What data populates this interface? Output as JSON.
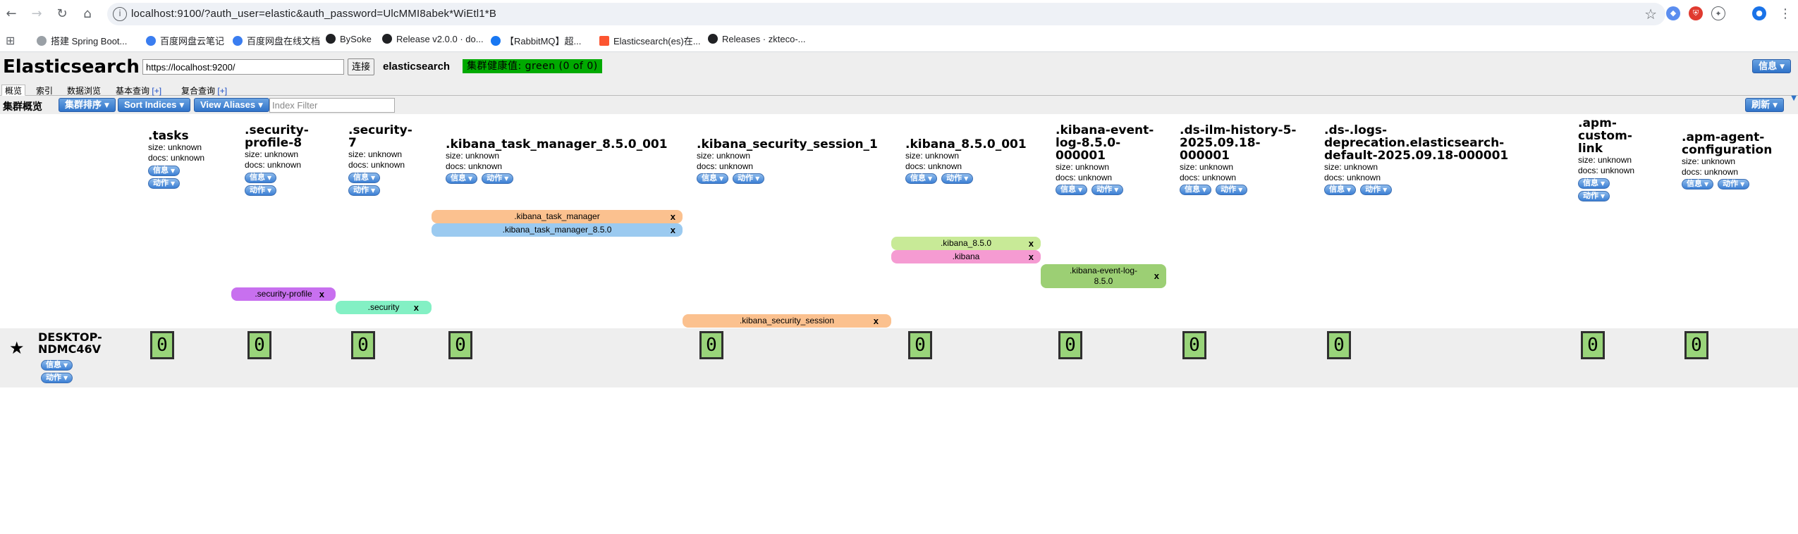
{
  "browser": {
    "url": "localhost:9100/?auth_user=elastic&auth_password=UlcMMI8abek*WiEtl1*B",
    "bookmarks": [
      "搭建 Spring Boot...",
      "百度网盘云笔记",
      "百度网盘在线文档",
      "BySoke",
      "Release v2.0.0 · do...",
      "【RabbitMQ】超...",
      "Elasticsearch(es)在...",
      "Releases · zkteco-..."
    ]
  },
  "app": {
    "title": "Elasticsearch",
    "connect_url": "https://localhost:9200/",
    "connect_label": "连接",
    "cluster_name": "elasticsearch",
    "health": "集群健康值: green (0 of 0)",
    "info_label": "信息",
    "tabs": [
      {
        "label": "概览"
      },
      {
        "label": "索引"
      },
      {
        "label": "数据浏览"
      },
      {
        "label": "基本查询",
        "plus": "[+]"
      },
      {
        "label": "复合查询",
        "plus": "[+]"
      }
    ],
    "toolbar": {
      "label": "集群概览",
      "sort_cluster": "集群排序",
      "sort_indices": "Sort Indices",
      "view_aliases": "View Aliases",
      "index_filter_placeholder": "Index Filter",
      "refresh": "刷新"
    }
  },
  "labels": {
    "size": "size: unknown",
    "docs": "docs: unknown",
    "info": "信息",
    "action": "动作"
  },
  "indices": [
    {
      "name": ".tasks"
    },
    {
      "name": ".security-profile-8"
    },
    {
      "name": ".security-7"
    },
    {
      "name": ".kibana_task_manager_8.5.0_001"
    },
    {
      "name": ".kibana_security_session_1"
    },
    {
      "name": ".kibana_8.5.0_001"
    },
    {
      "name": ".kibana-event-log-8.5.0-000001"
    },
    {
      "name": ".ds-ilm-history-5-2025.09.18-000001"
    },
    {
      "name": ".ds-.logs-deprecation.elasticsearch-default-2025.09.18-000001"
    },
    {
      "name": ".apm-custom-link"
    },
    {
      "name": ".apm-agent-configuration"
    }
  ],
  "aliases": [
    {
      "name": ".kibana_task_manager",
      "color": "#fbc18f"
    },
    {
      "name": ".kibana_task_manager_8.5.0",
      "color": "#9bcaf0"
    },
    {
      "name": ".kibana_8.5.0",
      "color": "#c8ea97"
    },
    {
      "name": ".kibana",
      "color": "#f59bd2"
    },
    {
      "name": ".kibana-event-log-8.5.0",
      "color": "#9ccf74"
    },
    {
      "name": ".security-profile",
      "color": "#c870ef"
    },
    {
      "name": ".security",
      "color": "#83f0c4"
    },
    {
      "name": ".kibana_security_session",
      "color": "#fbc18f"
    }
  ],
  "alias_close": "x",
  "node": {
    "name": "DESKTOP-NDMC46V",
    "shards": [
      "0",
      "0",
      "0",
      "0",
      "0",
      "0",
      "0",
      "0",
      "0",
      "0",
      "0"
    ]
  }
}
